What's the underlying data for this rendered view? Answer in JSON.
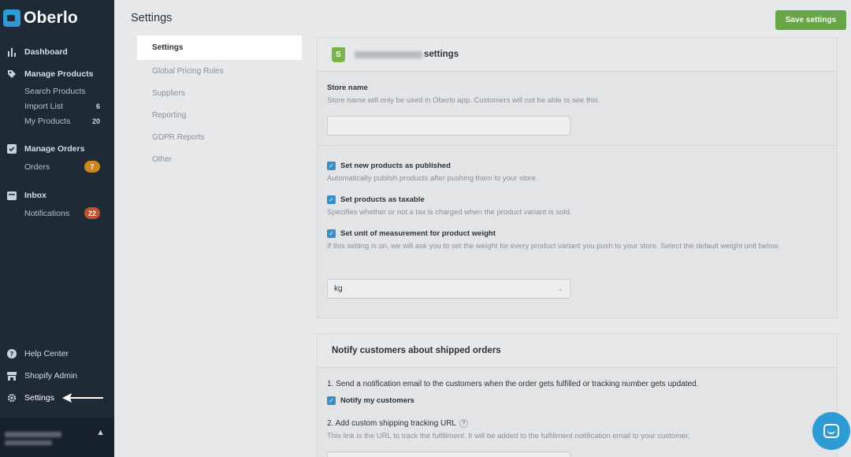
{
  "app": {
    "name": "Oberlo"
  },
  "sidebar": {
    "dashboard": "Dashboard",
    "manage_products": "Manage Products",
    "products_sub": [
      {
        "label": "Search Products",
        "count": ""
      },
      {
        "label": "Import List",
        "count": "6"
      },
      {
        "label": "My Products",
        "count": "20"
      }
    ],
    "manage_orders": "Manage Orders",
    "orders": {
      "label": "Orders",
      "count": "7"
    },
    "inbox": "Inbox",
    "notifications": {
      "label": "Notifications",
      "count": "22"
    },
    "help_center": "Help Center",
    "shopify_admin": "Shopify Admin",
    "settings": "Settings"
  },
  "header": {
    "title": "Settings",
    "save_label": "Save settings"
  },
  "settings_nav": [
    "Settings",
    "Global Pricing Rules",
    "Suppliers",
    "Reporting",
    "GDPR Reports",
    "Other"
  ],
  "store_card": {
    "title_suffix": "settings",
    "store_name_label": "Store name",
    "store_name_help": "Store name will only be used in Oberlo app. Customers will not be able to see this.",
    "store_name_value": "",
    "options": [
      {
        "label": "Set new products as published",
        "help": "Automatically publish products after pushing them to your store.",
        "checked": true
      },
      {
        "label": "Set products as taxable",
        "help": "Specifies whether or not a tax is charged when the product variant is sold.",
        "checked": true
      },
      {
        "label": "Set unit of measurement for product weight",
        "help": "If this setting is on, we will ask you to set the weight for every product variant you push to your store. Select the default weight unit below.",
        "checked": true
      }
    ],
    "weight_unit": "kg"
  },
  "notify_card": {
    "title": "Notify customers about shipped orders",
    "step1": "1. Send a notification email to the customers when the order gets fulfilled or tracking number gets updated.",
    "notify_label": "Notify my customers",
    "step2": "2. Add custom shipping tracking URL",
    "step2_help": "This link is the URL to track the fulfillment. It will be added to the fulfillment notification email to your customer.",
    "q": "?"
  },
  "colors": {
    "sidebar": "#1e2a36",
    "accent": "#2f9bd4",
    "save_button": "#69a548",
    "checkbox": "#3a8fc6"
  }
}
